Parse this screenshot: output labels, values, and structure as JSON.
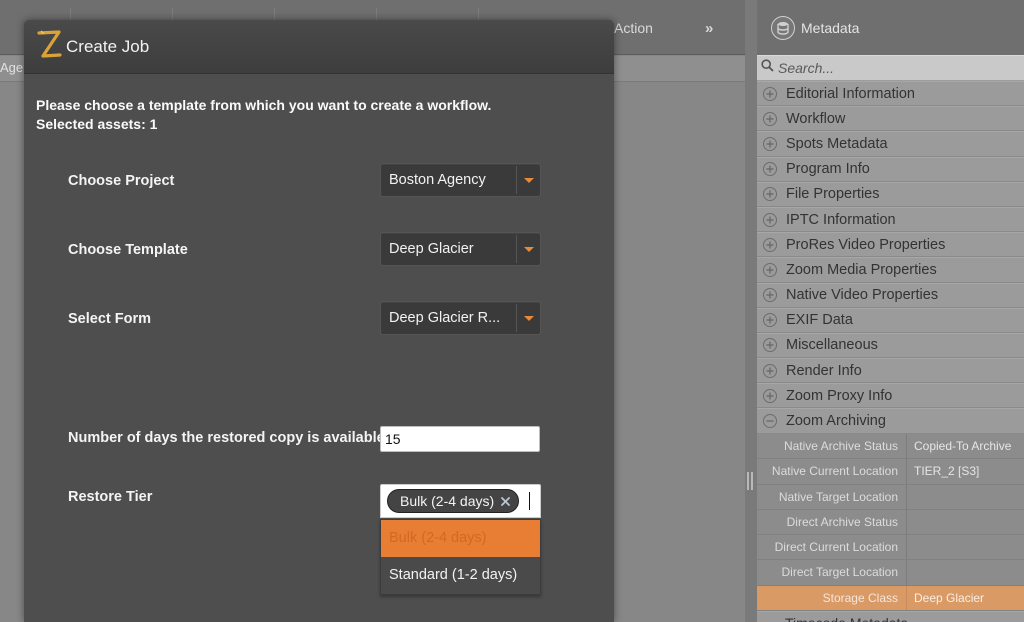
{
  "background": {
    "toolbar_action_label": "Action",
    "chevron_glyph": "»",
    "column_fragment": "Age"
  },
  "metadata_panel": {
    "title": "Metadata",
    "icon": "database-icon",
    "search_placeholder": "Search...",
    "sections": [
      {
        "label": "Editorial Information",
        "state": "collapsed"
      },
      {
        "label": "Workflow",
        "state": "collapsed"
      },
      {
        "label": "Spots Metadata",
        "state": "collapsed"
      },
      {
        "label": "Program Info",
        "state": "collapsed"
      },
      {
        "label": "File Properties",
        "state": "collapsed"
      },
      {
        "label": "IPTC Information",
        "state": "collapsed"
      },
      {
        "label": "ProRes Video Properties",
        "state": "collapsed"
      },
      {
        "label": "Zoom Media Properties",
        "state": "collapsed"
      },
      {
        "label": "Native Video Properties",
        "state": "collapsed"
      },
      {
        "label": "EXIF Data",
        "state": "collapsed"
      },
      {
        "label": "Miscellaneous",
        "state": "collapsed"
      },
      {
        "label": "Render Info",
        "state": "collapsed"
      },
      {
        "label": "Zoom Proxy Info",
        "state": "collapsed"
      },
      {
        "label": "Zoom Archiving",
        "state": "expanded"
      }
    ],
    "fields": [
      {
        "label": "Native Archive Status",
        "value": "Copied-To Archive"
      },
      {
        "label": "Native Current Location",
        "value": "TIER_2 [S3]"
      },
      {
        "label": "Native Target Location",
        "value": ""
      },
      {
        "label": "Direct Archive Status",
        "value": ""
      },
      {
        "label": "Direct Current Location",
        "value": ""
      },
      {
        "label": "Direct Target Location",
        "value": ""
      },
      {
        "label": "Storage Class",
        "value": "Deep Glacier",
        "highlighted": true
      }
    ],
    "cutoff_section": "Timecode Metadata",
    "highlight_color": "#d99a66"
  },
  "dialog": {
    "title": "Create Job",
    "logo_letter": "Z",
    "intro_line1": "Please choose a template from which you want to create a workflow.",
    "intro_line2": "Selected assets: 1",
    "project": {
      "label": "Choose Project",
      "value": "Boston Agency"
    },
    "template": {
      "label": "Choose Template",
      "value": "Deep Glacier"
    },
    "form": {
      "label": "Select Form",
      "value": "Deep Glacier R..."
    },
    "days": {
      "label": "Number of days the restored copy is available",
      "value": "15"
    },
    "tier": {
      "label": "Restore Tier",
      "selected": "Bulk (2-4 days)",
      "options": [
        "Bulk (2-4 days)",
        "Standard (1-2 days)"
      ]
    },
    "accent_color": "#e87d34"
  }
}
